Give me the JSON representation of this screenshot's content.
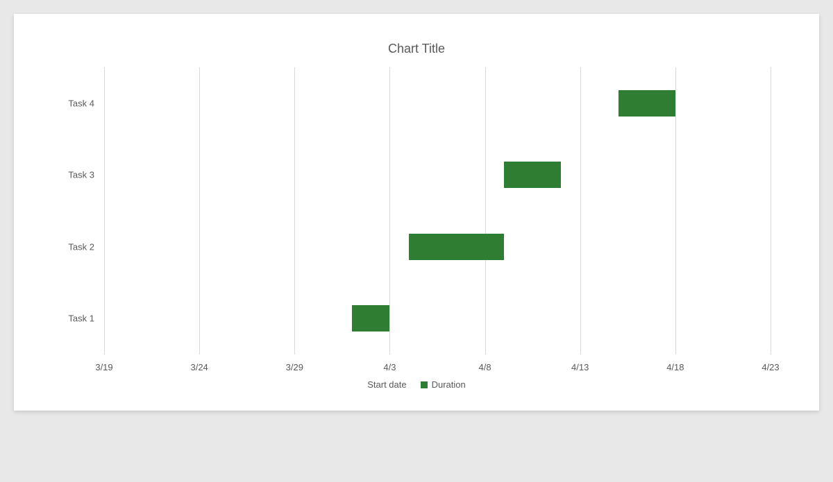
{
  "chart_data": {
    "type": "bar",
    "orientation": "horizontal",
    "title": "Chart Title",
    "categories": [
      "Task 1",
      "Task 2",
      "Task 3",
      "Task 4"
    ],
    "x_ticks": [
      "3/19",
      "3/24",
      "3/29",
      "4/3",
      "4/8",
      "4/13",
      "4/18",
      "4/23"
    ],
    "x_origin": "3/19",
    "x_step_days": 5,
    "series": [
      {
        "name": "Start date",
        "role": "offset",
        "values": [
          13,
          16,
          21,
          27
        ]
      },
      {
        "name": "Duration",
        "role": "value",
        "values": [
          2,
          5,
          3,
          3
        ]
      }
    ],
    "legend": [
      "Start date",
      "Duration"
    ],
    "bar_color": "#2f7d32"
  }
}
